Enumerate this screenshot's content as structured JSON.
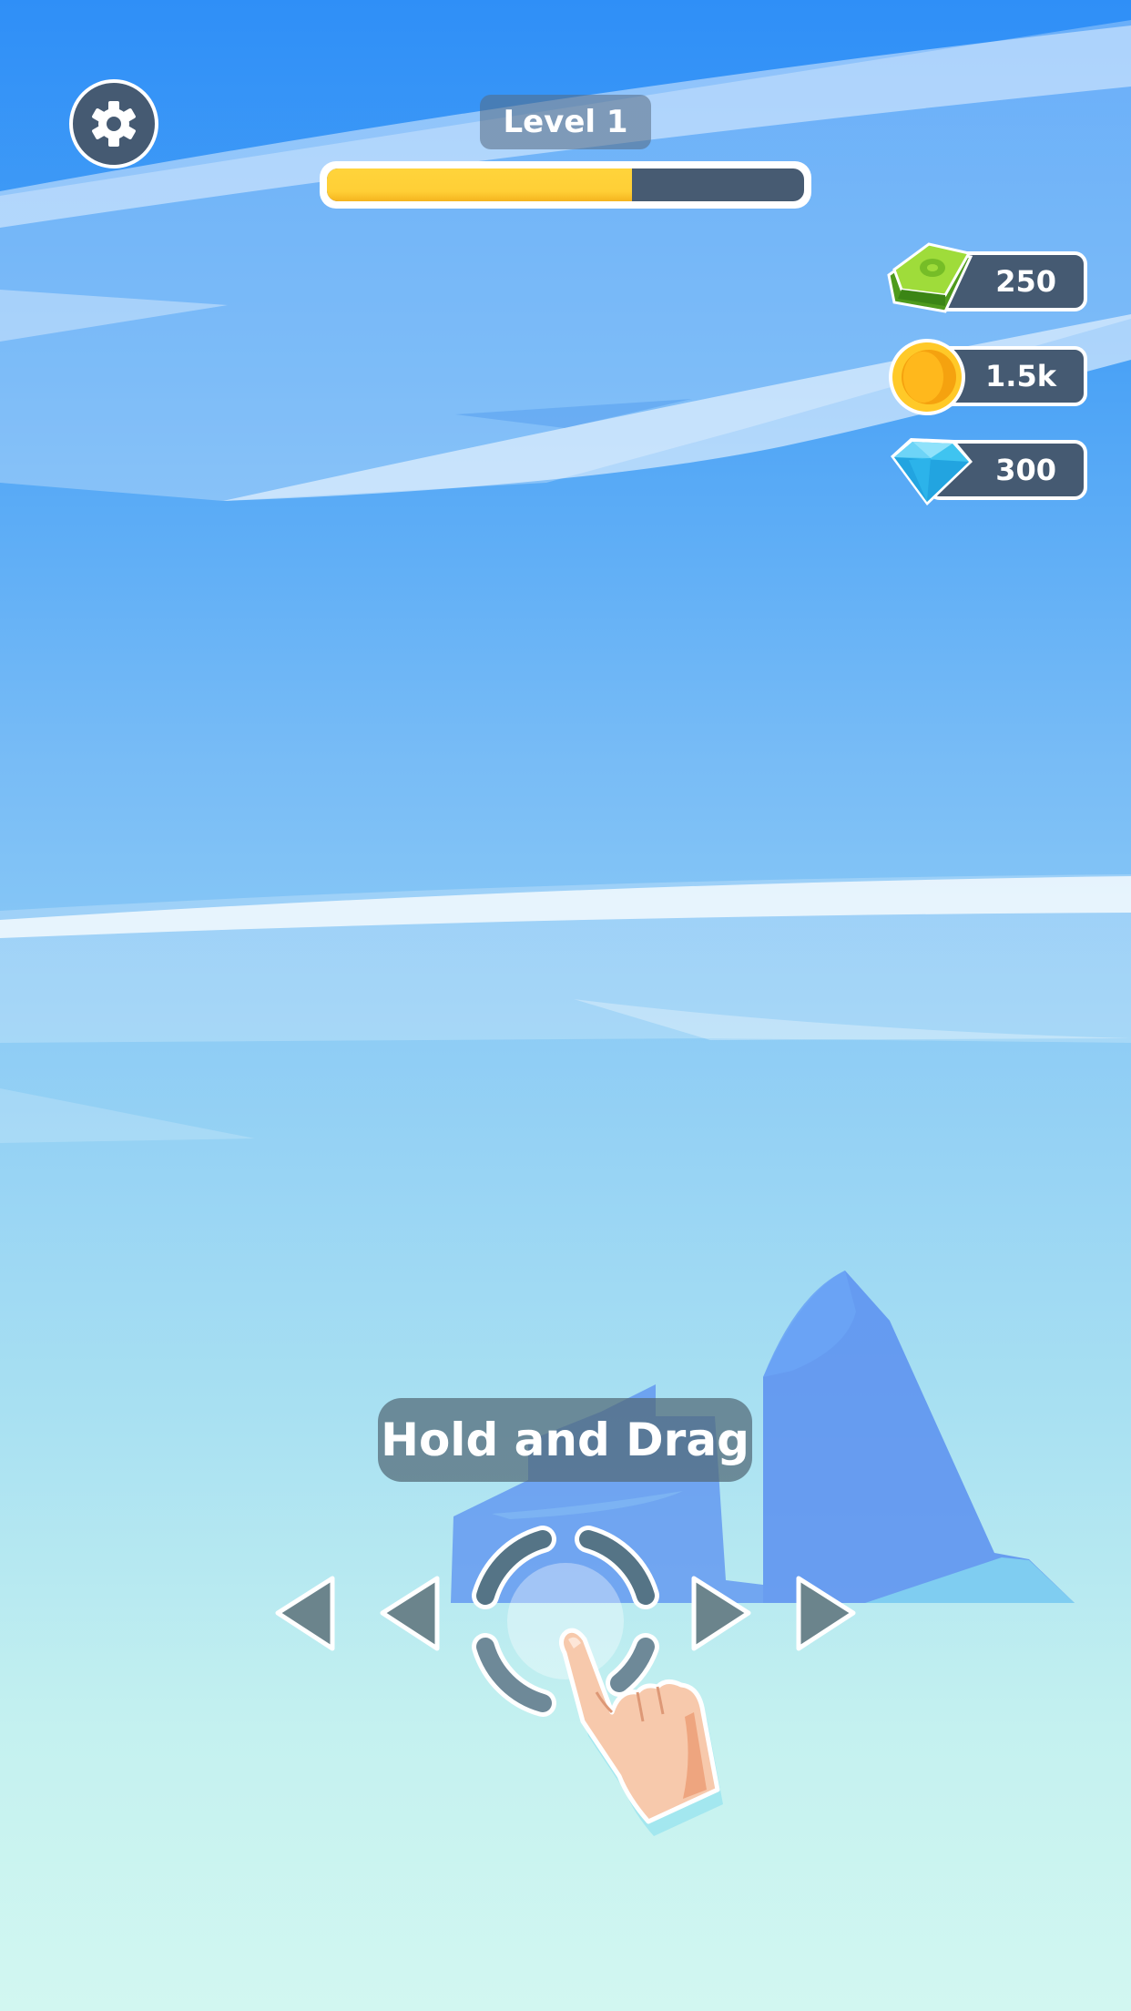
{
  "hud": {
    "level_label": "Level 1",
    "level_progress": 0.64,
    "settings_icon": "gear-icon"
  },
  "currencies": [
    {
      "name": "cash",
      "icon": "cash-icon",
      "value": "250"
    },
    {
      "name": "coins",
      "icon": "coin-icon",
      "value": "1.5k"
    },
    {
      "name": "gems",
      "icon": "diamond-icon",
      "value": "300"
    }
  ],
  "tutorial": {
    "hint_text": "Hold and Drag",
    "gesture_icon": "pointing-hand-icon"
  },
  "colors": {
    "sky_top": "#2f8ff7",
    "sky_bottom": "#d2f7f1",
    "hud_panel": "#455a72",
    "progress_fill": "#ffd43b"
  }
}
